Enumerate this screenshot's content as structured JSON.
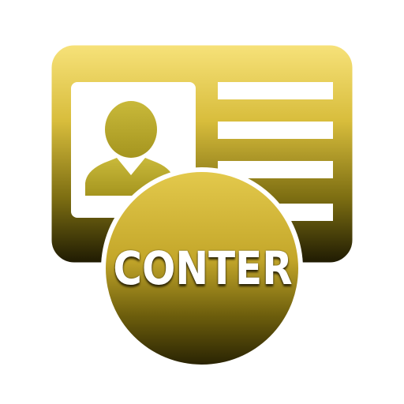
{
  "app_icon": {
    "badge_text": "CONTER",
    "card_icon_name": "id-card-icon",
    "avatar_icon_name": "user-avatar-icon",
    "colors": {
      "gold_light": "#f2dc70",
      "gold_mid": "#c9b033",
      "gold_dark": "#2f2a05",
      "avatar": "#b8a72a",
      "text_lines": "#ffffff"
    }
  }
}
